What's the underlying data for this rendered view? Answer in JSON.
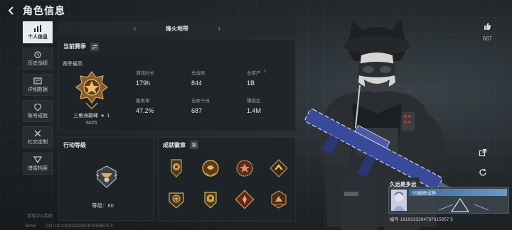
{
  "header": {
    "title": "角色信息"
  },
  "top_right": {
    "like_count": "687"
  },
  "sidebar": {
    "items": [
      {
        "label": "个人信息",
        "icon": "bar-chart-icon",
        "active": true
      },
      {
        "label": "历史战绩",
        "icon": "history-icon",
        "active": false
      },
      {
        "label": "详细数据",
        "icon": "data-icon",
        "active": false
      },
      {
        "label": "账号成就",
        "icon": "achievement-icon",
        "active": false
      },
      {
        "label": "社交定制",
        "icon": "tools-icon",
        "active": false
      },
      {
        "label": "借雷档案",
        "icon": "archive-icon",
        "active": false
      }
    ],
    "footer": "游戏中心奖励"
  },
  "status": {
    "ping": "63ms",
    "uid_line": "CN UID:18192332947878158575 3"
  },
  "map": {
    "name": "烽火地带"
  },
  "season": {
    "title": "当前赛季",
    "best_label": "赛季最高",
    "rank_name": "三角洲巅峰",
    "rank_stars": "1",
    "rank_score": "6025",
    "stats": [
      {
        "key": "游戏时长",
        "value": "179h"
      },
      {
        "key": "总战局",
        "value": "844"
      },
      {
        "key": "总资产",
        "value": "1B",
        "help": "?"
      },
      {
        "key": "撤离率",
        "value": "47.2%"
      },
      {
        "key": "击败干员",
        "value": "687"
      },
      {
        "key": "赚损比",
        "value": "1.4M"
      }
    ]
  },
  "action": {
    "title": "行动等级",
    "level_text": "等级：60"
  },
  "medals": {
    "title": "成就徽章",
    "count": 8
  },
  "player": {
    "name": "久远是多远",
    "title": "S5巅峰战神",
    "uid": "编号 1819233294787815957 5"
  },
  "colors": {
    "accent": "#e9ecee",
    "gold": "#c8a050",
    "bg": "#1a1e22"
  }
}
